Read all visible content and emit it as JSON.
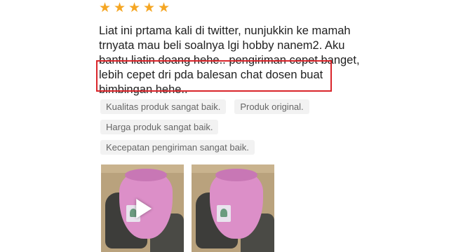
{
  "review": {
    "rating": 5,
    "star_icon": "star-icon",
    "star_color": "#f5a623",
    "text_lines": [
      "Liat ini prtama kali di twitter, nunjukkin ke mamah",
      "trnyata mau beli soalnya lgi hobby nanem2. Aku",
      "bantu liatin doang hehe.. pengiriman cepet banget,",
      "lebih cepet dri pda balesan chat dosen buat",
      "bimbingan hehe.."
    ],
    "highlight_color": "#d9252a"
  },
  "tags": [
    [
      "Kualitas produk sangat baik.",
      "Produk original."
    ],
    [
      "Harga produk sangat baik."
    ],
    [
      "Kecepatan pengiriman sangat baik."
    ]
  ],
  "media": [
    {
      "type": "video",
      "icon": "play-icon"
    },
    {
      "type": "image"
    }
  ]
}
